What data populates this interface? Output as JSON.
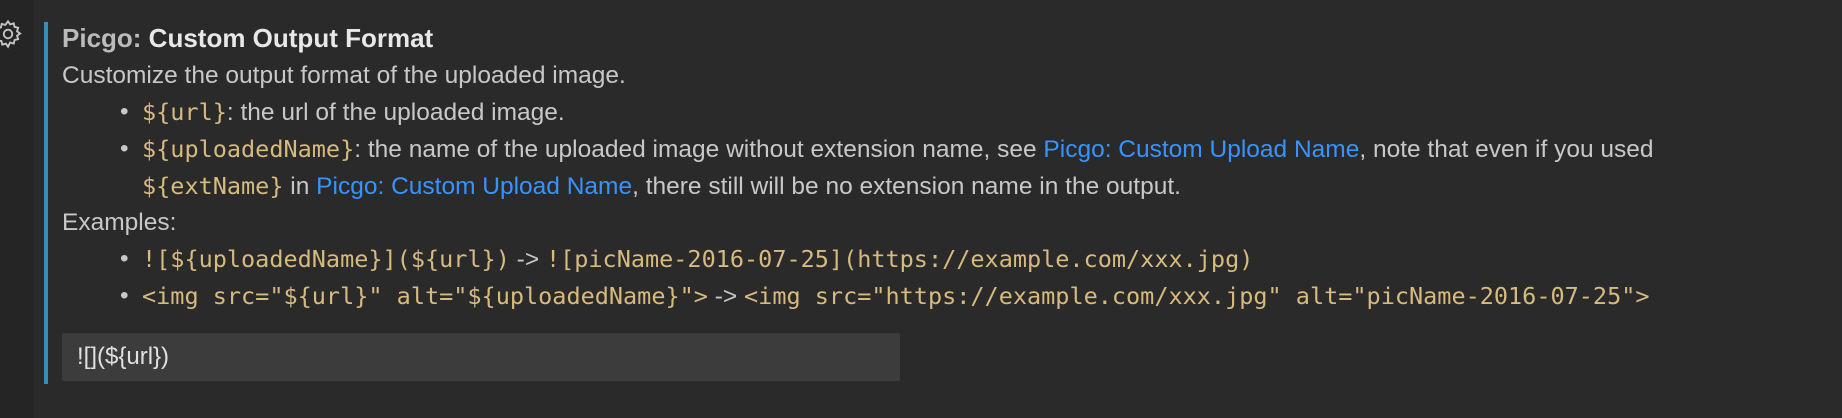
{
  "setting": {
    "category": "Picgo: ",
    "name": "Custom Output Format",
    "description_intro": "Customize the output format of the uploaded image.",
    "items": [
      {
        "code": "${url}",
        "text": ": the url of the uploaded image."
      },
      {
        "code": "${uploadedName}",
        "text_a": ": the name of the uploaded image without extension name, see ",
        "link_1": "Picgo: Custom Upload Name",
        "text_b": ", note that even if you used",
        "code_2": "${extName}",
        "text_c": " in ",
        "link_2": "Picgo: Custom Upload Name",
        "text_d": ", there still will be no extension name in the output."
      }
    ],
    "examples_label": "Examples:",
    "examples": [
      {
        "code_a": "![${uploadedName}](${url})",
        "arrow": " -> ",
        "code_b": "![picName-2016-07-25](https://example.com/xxx.jpg)"
      },
      {
        "code_a": "<img src=\"${url}\" alt=\"${uploadedName}\">",
        "arrow": " -> ",
        "code_b": "<img src=\"https://example.com/xxx.jpg\" alt=\"picName-2016-07-25\">"
      }
    ],
    "input_value": "![](${url})"
  },
  "icons": {
    "gear": "gear-icon"
  },
  "colors": {
    "focus_bar": "#3b8eb5",
    "code": "#d7ba7d",
    "link": "#3794ff",
    "background": "#2a2a2b"
  }
}
